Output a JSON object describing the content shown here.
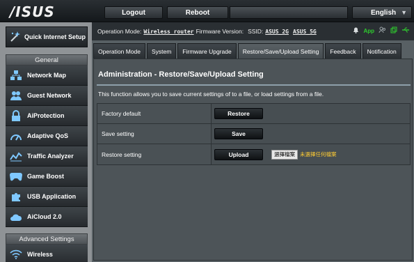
{
  "brand": {
    "logo": "/ISUS"
  },
  "topbar": {
    "logout_label": "Logout",
    "reboot_label": "Reboot",
    "language": "English"
  },
  "sidebar": {
    "quick_setup_label": "Quick Internet Setup",
    "general_header": "General",
    "general_items": [
      {
        "label": "Network Map",
        "icon": "network-map-icon"
      },
      {
        "label": "Guest Network",
        "icon": "guest-network-icon"
      },
      {
        "label": "AiProtection",
        "icon": "lock-icon"
      },
      {
        "label": "Adaptive QoS",
        "icon": "speedometer-icon"
      },
      {
        "label": "Traffic Analyzer",
        "icon": "traffic-chart-icon"
      },
      {
        "label": "Game Boost",
        "icon": "gamepad-icon"
      },
      {
        "label": "USB Application",
        "icon": "puzzle-icon"
      },
      {
        "label": "AiCloud 2.0",
        "icon": "cloud-icon"
      }
    ],
    "advanced_header": "Advanced Settings",
    "advanced_items": [
      {
        "label": "Wireless",
        "icon": "wifi-icon"
      }
    ]
  },
  "status": {
    "mode_label": "Operation Mode:",
    "mode_value": "Wireless router",
    "firmware_label": "Firmware Version:",
    "ssid_label": "SSID:",
    "ssid_24": "ASUS_2G",
    "ssid_5": "ASUS_5G",
    "app_label": "App"
  },
  "tabs": [
    {
      "label": "Operation Mode",
      "active": false
    },
    {
      "label": "System",
      "active": false
    },
    {
      "label": "Firmware Upgrade",
      "active": false
    },
    {
      "label": "Restore/Save/Upload Setting",
      "active": true
    },
    {
      "label": "Feedback",
      "active": false
    },
    {
      "label": "Notification",
      "active": false
    }
  ],
  "page": {
    "title": "Administration - Restore/Save/Upload Setting",
    "description": "This function allows you to save current settings of to a file, or load settings from a file.",
    "rows": [
      {
        "label": "Factory default",
        "button": "Restore"
      },
      {
        "label": "Save setting",
        "button": "Save"
      },
      {
        "label": "Restore setting",
        "button": "Upload",
        "file_button": "選擇檔案",
        "file_status": "未選擇任何檔案"
      }
    ]
  },
  "colors": {
    "accent_green": "#2ecc2e",
    "file_status": "#ffcc33",
    "panel_bg": "#4d5458"
  }
}
